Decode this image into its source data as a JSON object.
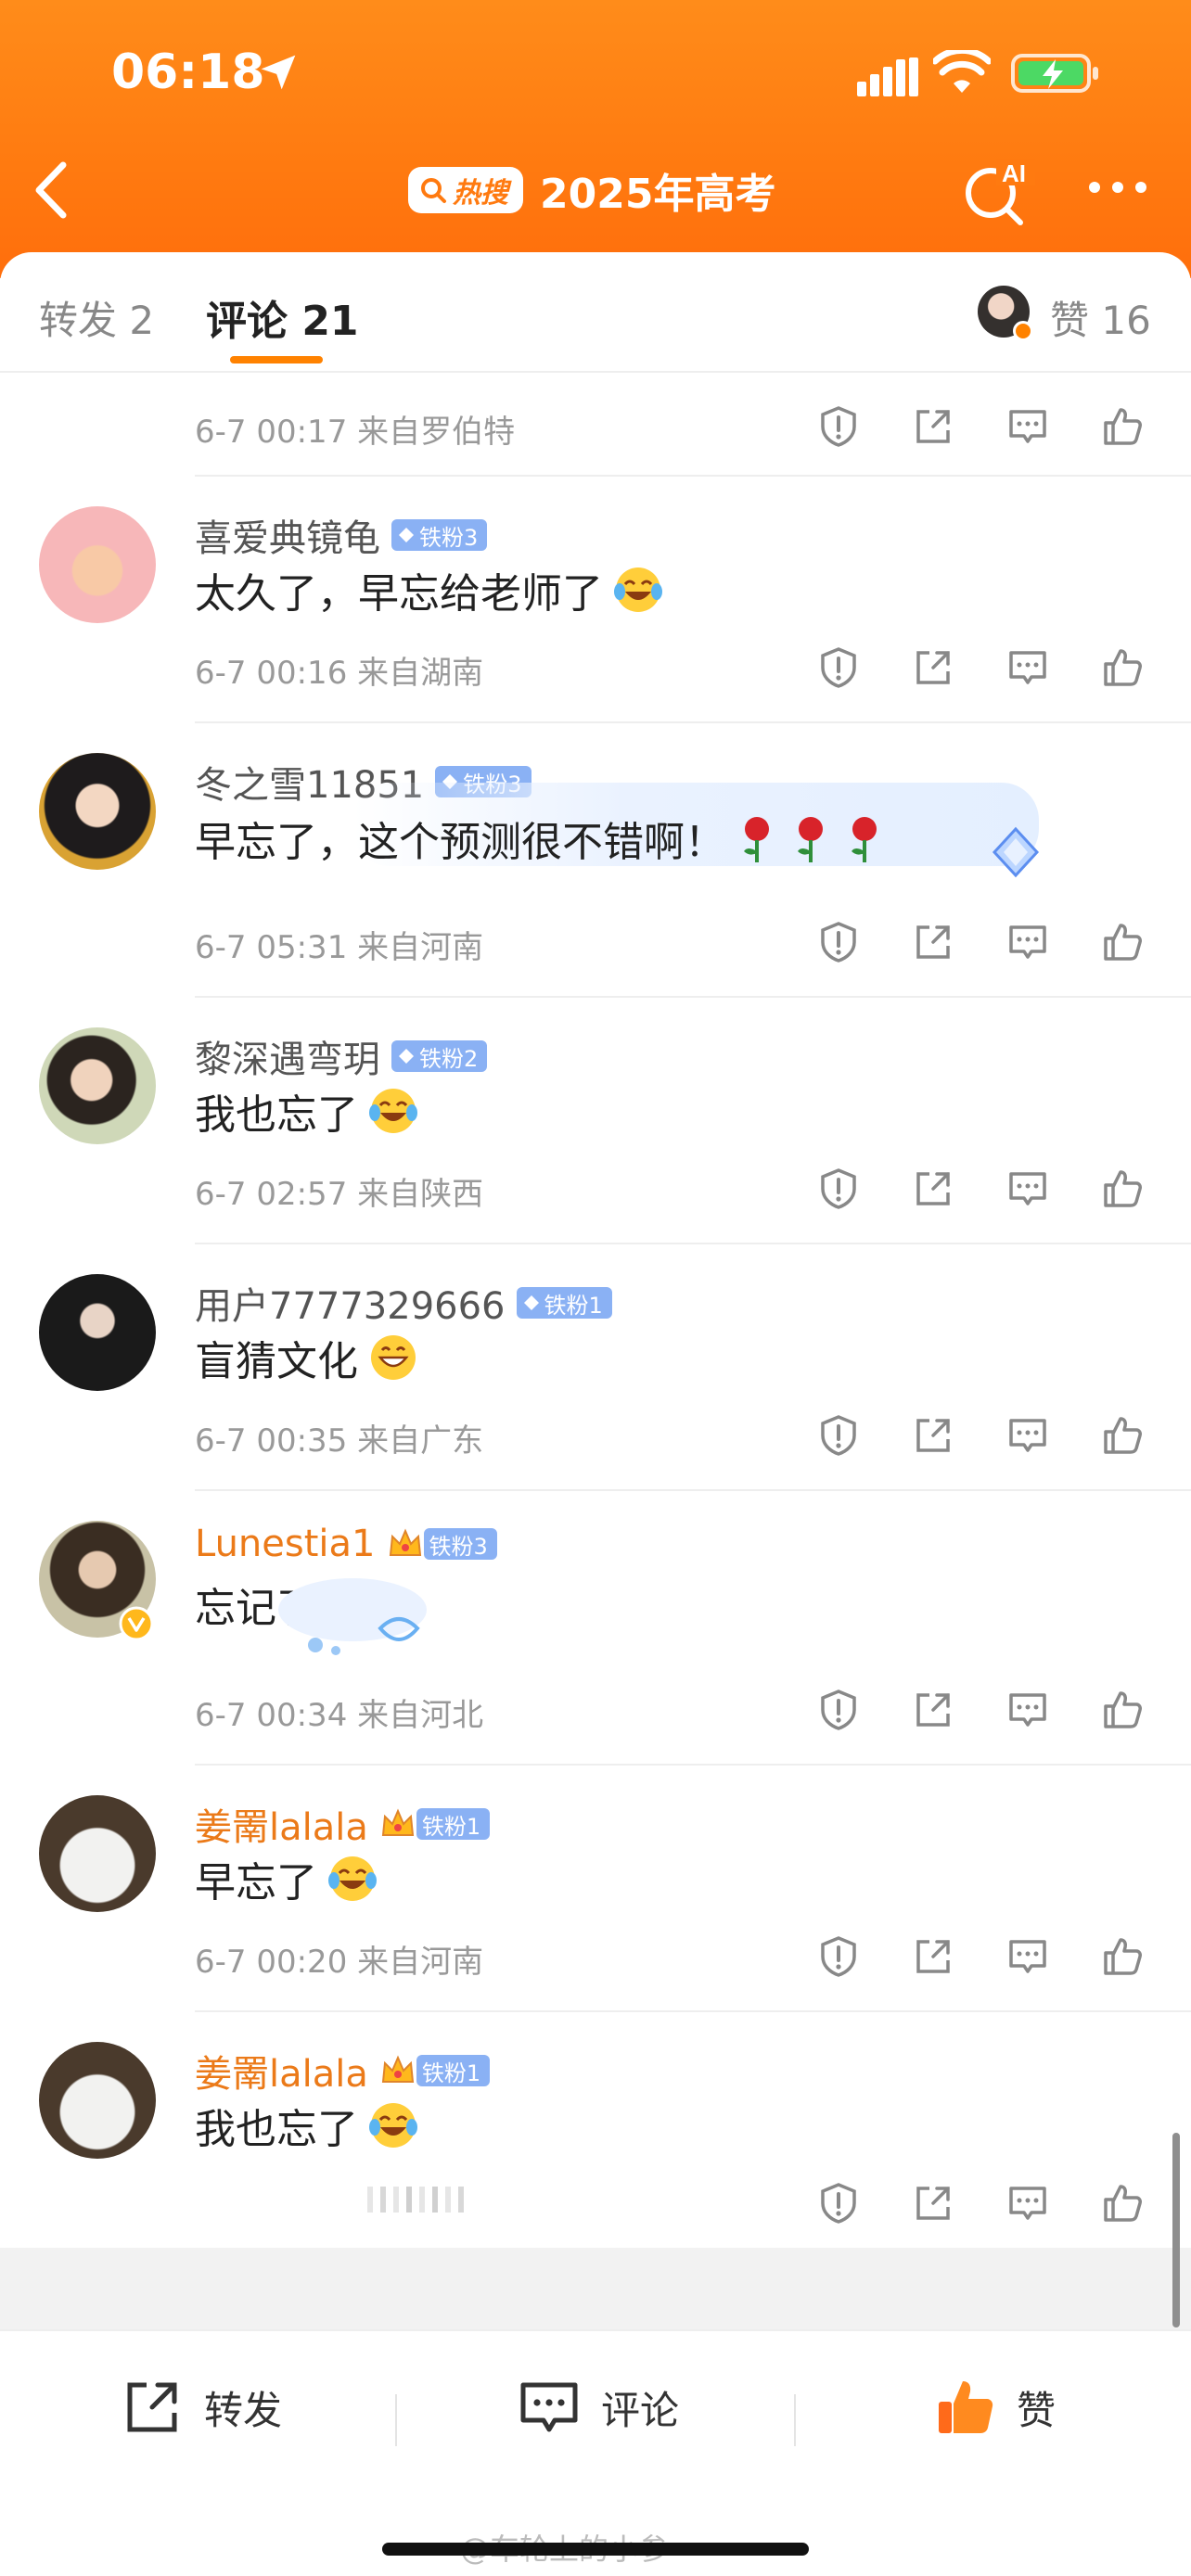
{
  "status_bar": {
    "time": "06:18"
  },
  "nav": {
    "hot_label": "热搜",
    "title": "2025年高考",
    "ai_label": "AI"
  },
  "tabs": {
    "repost": "转发 2",
    "comment": "评论 21",
    "like": "赞 16"
  },
  "colors": {
    "accent": "#ff8200",
    "header": "#ff7a10",
    "fan_badge": "#8ab1f4",
    "vip_name": "#eb7a19"
  },
  "comments": [
    {
      "meta": "6-7 00:17 来自罗伯特"
    },
    {
      "username": "喜爱典镜龟",
      "badge": "铁粉3",
      "text": "太久了，早忘给老师了",
      "emoji": "laugh-cry-emoji",
      "meta": "6-7 00:16 来自湖南"
    },
    {
      "username": "冬之雪11851",
      "badge": "铁粉3",
      "text": "早忘了，这个预测很不错啊！",
      "emoji": "rose-emoji",
      "meta": "6-7 05:31 来自河南"
    },
    {
      "username": "黎深遇弯玥",
      "badge": "铁粉2",
      "text": "我也忘了",
      "emoji": "laugh-cry-emoji",
      "meta": "6-7 02:57 来自陕西"
    },
    {
      "username": "用户7777329666",
      "badge": "铁粉1",
      "text": "盲猜文化",
      "emoji": "grin-emoji",
      "meta": "6-7 00:35 来自广东"
    },
    {
      "username": "Lunestia1",
      "badge": "铁粉3",
      "text": "忘记了",
      "meta": "6-7 00:34 来自河北"
    },
    {
      "username": "姜罱lalala",
      "badge": "铁粉1",
      "text": "早忘了",
      "emoji": "laugh-cry-emoji",
      "meta": "6-7 00:20 来自河南"
    },
    {
      "username": "姜罱lalala",
      "badge": "铁粉1",
      "text": "我也忘了",
      "emoji": "laugh-cry-emoji"
    }
  ],
  "bottom_bar": {
    "repost": "转发",
    "comment": "评论",
    "like": "赞"
  },
  "watermark": "@车轮上的小参"
}
